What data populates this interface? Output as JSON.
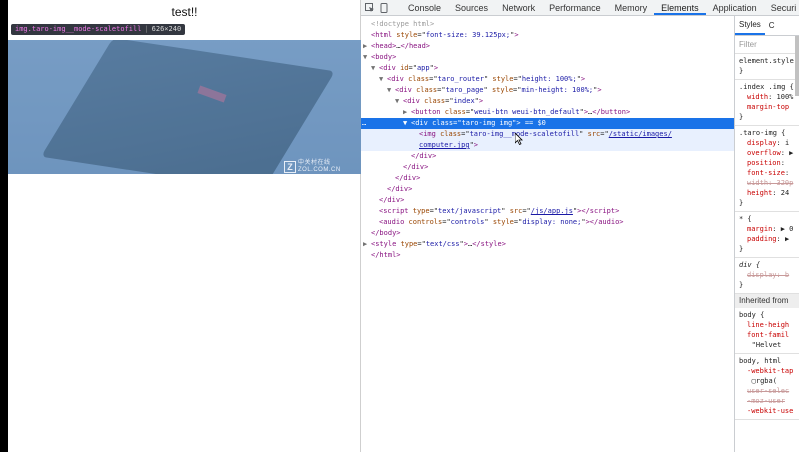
{
  "preview": {
    "title": "test!!",
    "tooltip": {
      "tag": "img.taro-img__mode-scaletofill",
      "size": "626×240"
    },
    "watermark": {
      "mark": "Z",
      "line1": "中关村在线",
      "line2": "ZOL.COM.CN"
    }
  },
  "devtools": {
    "tabs": [
      "Console",
      "Sources",
      "Network",
      "Performance",
      "Memory",
      "Elements",
      "Application",
      "Securi"
    ],
    "active_tab": "Elements",
    "dom_lines": [
      {
        "indent": 0,
        "arrow": "",
        "html": "<span class='dt'>&lt;!doctype html&gt;</span>"
      },
      {
        "indent": 0,
        "arrow": "",
        "html": "<span class='tg'>&lt;html</span> <span class='at'>style</span>=\"<span class='av'>font-size: 39.125px;</span>\"<span class='tg'>&gt;</span>"
      },
      {
        "indent": 0,
        "arrow": "▶",
        "html": "<span class='tg'>&lt;head&gt;</span>…<span class='tg'>&lt;/head&gt;</span>"
      },
      {
        "indent": 0,
        "arrow": "▼",
        "html": "<span class='tg'>&lt;body&gt;</span>"
      },
      {
        "indent": 1,
        "arrow": "▼",
        "html": "<span class='tg'>&lt;div</span> <span class='at'>id</span>=\"<span class='av'>app</span>\"<span class='tg'>&gt;</span>"
      },
      {
        "indent": 2,
        "arrow": "▼",
        "html": "<span class='tg'>&lt;div</span> <span class='at'>class</span>=\"<span class='av'>taro_router</span>\" <span class='at'>style</span>=\"<span class='av'>height: 100%;</span>\"<span class='tg'>&gt;</span>"
      },
      {
        "indent": 3,
        "arrow": "▼",
        "html": "<span class='tg'>&lt;div</span> <span class='at'>class</span>=\"<span class='av'>taro_page</span>\" <span class='at'>style</span>=\"<span class='av'>min-height: 100%;</span>\"<span class='tg'>&gt;</span>"
      },
      {
        "indent": 4,
        "arrow": "▼",
        "html": "<span class='tg'>&lt;div</span> <span class='at'>class</span>=\"<span class='av'>index</span>\"<span class='tg'>&gt;</span>"
      },
      {
        "indent": 5,
        "arrow": "▶",
        "html": "<span class='tg'>&lt;button</span> <span class='at'>class</span>=\"<span class='av'>weui-btn weui-btn_default</span>\"<span class='tg'>&gt;</span>…<span class='tg'>&lt;/button&gt;</span>"
      },
      {
        "indent": 5,
        "arrow": "▼",
        "selected": true,
        "html": "<span class='tg'>&lt;div</span> <span class='at'>class</span>=\"<span class='av'>taro-img img</span>\"<span class='tg'>&gt;</span> <span class='cm'>== $0</span>"
      },
      {
        "indent": 6,
        "arrow": "",
        "hover": true,
        "html": "<span class='tg'>&lt;img</span> <span class='at'>class</span>=\"<span class='av'>taro-img__mode-scaletofill</span>\" <span class='at'>src</span>=\"<span class='lnk'>/static/images/</span>"
      },
      {
        "indent": 6,
        "arrow": "",
        "hover": true,
        "html": "<span class='lnk'>computer.jpg</span>\"<span class='tg'>&gt;</span>"
      },
      {
        "indent": 5,
        "arrow": "",
        "html": "<span class='tg'>&lt;/div&gt;</span>"
      },
      {
        "indent": 4,
        "arrow": "",
        "html": "<span class='tg'>&lt;/div&gt;</span>"
      },
      {
        "indent": 3,
        "arrow": "",
        "html": "<span class='tg'>&lt;/div&gt;</span>"
      },
      {
        "indent": 2,
        "arrow": "",
        "html": "<span class='tg'>&lt;/div&gt;</span>"
      },
      {
        "indent": 1,
        "arrow": "",
        "html": "<span class='tg'>&lt;/div&gt;</span>"
      },
      {
        "indent": 1,
        "arrow": "",
        "html": "<span class='tg'>&lt;script</span> <span class='at'>type</span>=\"<span class='av'>text/javascript</span>\" <span class='at'>src</span>=\"<span class='lnk'>/js/app.js</span>\"<span class='tg'>&gt;&lt;/script&gt;</span>"
      },
      {
        "indent": 1,
        "arrow": "",
        "html": "<span class='tg'>&lt;audio</span> <span class='at'>controls</span>=\"<span class='av'>controls</span>\" <span class='at'>style</span>=\"<span class='av'>display: none;</span>\"<span class='tg'>&gt;&lt;/audio&gt;</span>"
      },
      {
        "indent": 0,
        "arrow": "",
        "html": "<span class='tg'>&lt;/body&gt;</span>"
      },
      {
        "indent": 0,
        "arrow": "▶",
        "html": "<span class='tg'>&lt;style</span> <span class='at'>type</span>=\"<span class='av'>text/css</span>\"<span class='tg'>&gt;</span>…<span class='tg'>&lt;/style&gt;</span>"
      },
      {
        "indent": 0,
        "arrow": "",
        "html": "<span class='tg'>&lt;/html&gt;</span>"
      }
    ],
    "styles": {
      "tab_styles": "Styles",
      "tab_computed": "C",
      "filter_placeholder": "Filter",
      "element_style": "element.style",
      "inherited_label": "Inherited from"
    }
  }
}
